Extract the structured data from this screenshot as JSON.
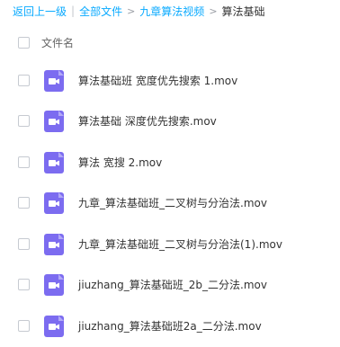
{
  "breadcrumb": {
    "back_label": "返回上一级",
    "all_files_label": "全部文件",
    "parent_folder_label": "九章算法视频",
    "current_folder_label": "算法基础",
    "arrow_glyph": ">"
  },
  "list_header": {
    "name_column_label": "文件名"
  },
  "files": [
    {
      "name": "算法基础班 宽度优先搜索 1.mov",
      "icon": "video-file-icon"
    },
    {
      "name": "算法基础 深度优先搜索.mov",
      "icon": "video-file-icon"
    },
    {
      "name": "算法 宽搜 2.mov",
      "icon": "video-file-icon"
    },
    {
      "name": "九章_算法基础班_二叉树与分治法.mov",
      "icon": "video-file-icon"
    },
    {
      "name": "九章_算法基础班_二叉树与分治法(1).mov",
      "icon": "video-file-icon"
    },
    {
      "name": "jiuzhang_算法基础班_2b_二分法.mov",
      "icon": "video-file-icon"
    },
    {
      "name": "jiuzhang_算法基础班2a_二分法.mov",
      "icon": "video-file-icon"
    }
  ],
  "colors": {
    "link": "#09aaff",
    "video_icon": "#7c6cf0"
  }
}
